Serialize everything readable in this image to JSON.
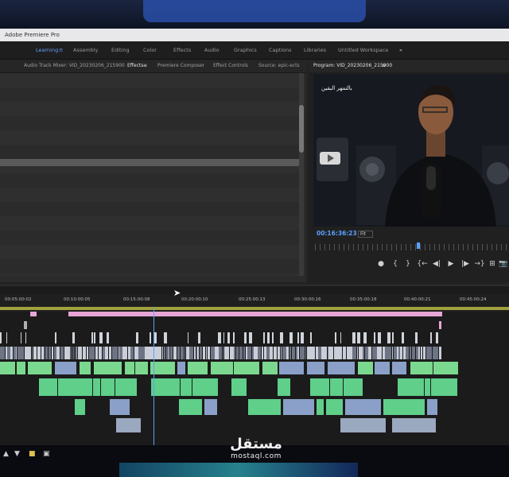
{
  "window": {
    "title": "Adobe Premiere Pro"
  },
  "workspaces": {
    "items": [
      "Learning",
      "Assembly",
      "Editing",
      "Color",
      "Effects",
      "Audio",
      "Graphics",
      "Captions",
      "Libraries",
      "Untitled Workspace"
    ],
    "active": "Learning",
    "more_symbol": "»"
  },
  "left_panel": {
    "tabs": [
      "Audio Track Mixer: VID_20230206_215900",
      "Effects",
      "Premiere Composer",
      "Effect Controls",
      "Source: epic-ects"
    ],
    "active_tab": "Effects"
  },
  "program_monitor": {
    "title": "Program: VID_20230206_215900",
    "menu_symbol": "≡",
    "timecode": "00:16:36:23",
    "fit": "Fit",
    "overlay_text": "بالتمهر البقين"
  },
  "transport": {
    "buttons": [
      "●",
      "{",
      "}",
      "{←",
      "◀|",
      "▶",
      "|▶",
      "→}",
      "⊞",
      "📷"
    ]
  },
  "timeline": {
    "ruler_timecodes": [
      "00:05:00:02",
      "00:10:00:05",
      "00:15:00:08",
      "00:20:00:10",
      "00:25:00:13",
      "00:30:00:16",
      "00:35:00:18",
      "00:40:00:21",
      "00:45:00:24"
    ]
  },
  "watermark": {
    "arabic": "مستقل",
    "latin": "mostaql.com"
  },
  "colors": {
    "accent": "#6aa0ff",
    "video_clip": "#8aa0c8",
    "audio_clip": "#5fcf8a",
    "work_area": "#e8a6d6",
    "playhead": "#5aa0ff"
  }
}
